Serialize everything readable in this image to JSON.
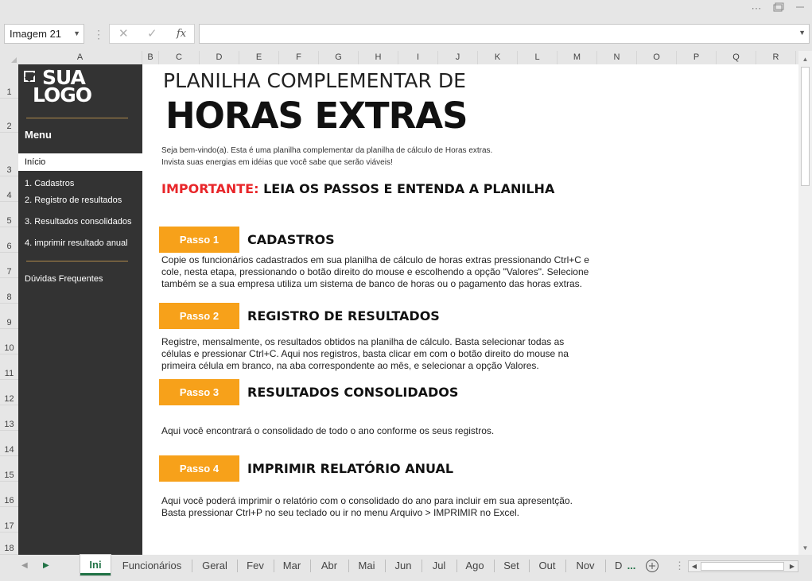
{
  "window": {
    "more_icon": "⋯",
    "restore_icon": "restore-icon",
    "minimize_icon": "minimize-icon"
  },
  "formula_bar": {
    "name_box": "Imagem 21",
    "cancel_icon": "✕",
    "enter_icon": "✓",
    "fx_label": "fx",
    "formula": ""
  },
  "columns": [
    "A",
    "B",
    "C",
    "D",
    "E",
    "F",
    "G",
    "H",
    "I",
    "J",
    "K",
    "L",
    "M",
    "N",
    "O",
    "P",
    "Q",
    "R"
  ],
  "rows": [
    "1",
    "2",
    "3",
    "4",
    "5",
    "6",
    "7",
    "8",
    "9",
    "10",
    "11",
    "12",
    "13",
    "14",
    "15",
    "16",
    "17",
    "18"
  ],
  "sidebar": {
    "logo_line1": "SUA",
    "logo_line2": "LOGO",
    "menu_title": "Menu",
    "active_item": "Início",
    "items": [
      "1. Cadastros",
      "2. Registro de resultados",
      "3. Resultados consolidados",
      "4. imprimir resultado anual"
    ],
    "faq": "Dúvidas Frequentes"
  },
  "main": {
    "title_line1": "PLANILHA COMPLEMENTAR DE",
    "title_line2": "HORAS EXTRAS",
    "intro_line1": "Seja bem-vindo(a). Esta é uma planilha complementar da planilha de cálculo de Horas extras.",
    "intro_line2": "Invista suas energias em idéias que você sabe que serão viáveis!",
    "important_label": "IMPORTANTE:",
    "important_text": " LEIA OS PASSOS E ENTENDA A PLANILHA",
    "steps": [
      {
        "badge": "Passo 1",
        "title": "CADASTROS",
        "desc": "Copie os funcionários cadastrados em sua planilha de cálculo de horas extras pressionando Ctrl+C e cole, nesta etapa, pressionando o botão direito do mouse e escolhendo a opção \"Valores\". Selecione também se a sua empresa utiliza um sistema de banco de horas ou o pagamento das horas extras."
      },
      {
        "badge": "Passo 2",
        "title": "REGISTRO DE RESULTADOS",
        "desc": "Registre, mensalmente, os resultados obtidos na planilha de cálculo. Basta selecionar todas as células e pressionar Ctrl+C. Aqui nos registros, basta clicar em com o botão direito do mouse na primeira célula em branco, na aba correspondente ao mês, e selecionar a opção Valores."
      },
      {
        "badge": "Passo 3",
        "title": "RESULTADOS CONSOLIDADOS",
        "desc": "Aqui você encontrará o consolidado de todo o ano conforme os seus registros."
      },
      {
        "badge": "Passo 4",
        "title": "IMPRIMIR RELATÓRIO ANUAL",
        "desc": "Aqui você poderá imprimir o relatório com o consolidado do ano para incluir em sua apresentção. Basta pressionar Ctrl+P no seu teclado ou ir no menu Arquivo > IMPRIMIR no Excel."
      }
    ]
  },
  "tabs": [
    "Ini",
    "Funcionários",
    "Geral",
    "Fev",
    "Mar",
    "Abr",
    "Mai",
    "Jun",
    "Jul",
    "Ago",
    "Set",
    "Out",
    "Nov",
    "D"
  ],
  "tab_more": "...",
  "add_sheet": "+",
  "accent_color": "#217346",
  "step_color": "#f7a11a",
  "important_color": "#e8262a"
}
